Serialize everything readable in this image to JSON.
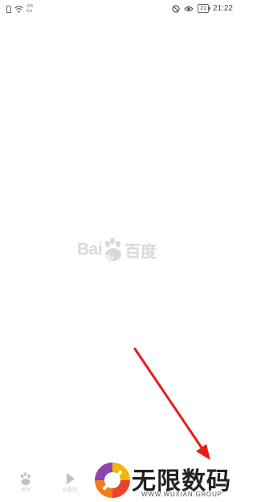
{
  "status_bar": {
    "net_speed_value": "435",
    "net_speed_unit": "K/s",
    "battery": "21",
    "time": "21:22"
  },
  "splash": {
    "logo_text_latin": "Bai",
    "logo_paw_text": "du",
    "logo_text_cn": "百度"
  },
  "bottom_nav": {
    "items": [
      {
        "label": "首页",
        "icon": "paw-icon"
      },
      {
        "label": "好看视",
        "icon": "play-icon"
      }
    ]
  },
  "watermark": {
    "title": "无限数码",
    "subtitle": "WWW.WUXIAN.GROUP"
  },
  "colors": {
    "annotation_arrow": "#e81c1c",
    "watermark_text": "#222222"
  }
}
